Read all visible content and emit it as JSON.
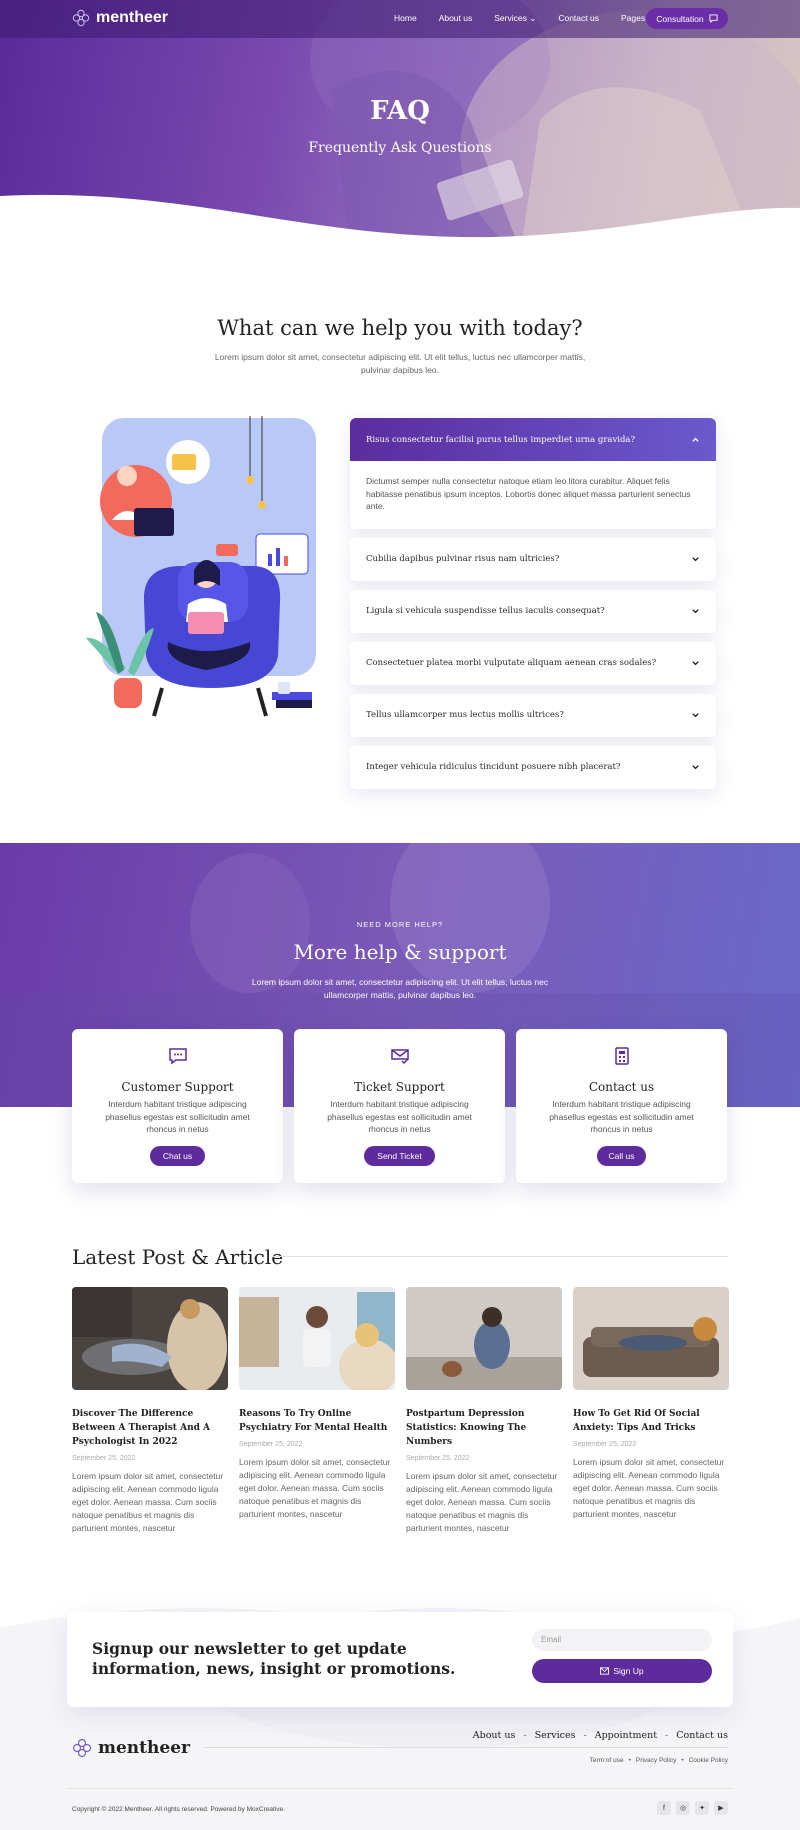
{
  "header": {
    "brand": "mentheer",
    "menu": [
      {
        "label": "Home",
        "dropdown": false
      },
      {
        "label": "About us",
        "dropdown": false
      },
      {
        "label": "Services",
        "dropdown": true
      },
      {
        "label": "Contact us",
        "dropdown": false
      },
      {
        "label": "Pages",
        "dropdown": true
      }
    ],
    "cta_label": "Consultation",
    "cta_icon": "message-square-icon"
  },
  "hero": {
    "title": "FAQ",
    "subtitle": "Frequently Ask Questions"
  },
  "help": {
    "title": "What can we help you with today?",
    "description": "Lorem ipsum dolor sit amet, consectetur adipiscing elit. Ut elit tellus, luctus nec ullamcorper mattis, pulvinar dapibus leo."
  },
  "faq": {
    "items": [
      {
        "question": "Risus consectetur facilisi purus tellus imperdiet urna gravida?",
        "answer": "Dictumst semper nulla consectetur natoque etiam leo litora curabitur. Aliquet felis habitasse penatibus ipsum inceptos. Lobortis donec aliquet massa parturient senectus ante.",
        "open": true
      },
      {
        "question": "Cubilia dapibus pulvinar risus nam ultricies?",
        "open": false
      },
      {
        "question": "Ligula si vehicula suspendisse tellus iaculis consequat?",
        "open": false
      },
      {
        "question": "Consectetuer platea morbi vulputate aliquam aenean cras sodales?",
        "open": false
      },
      {
        "question": "Tellus ullamcorper mus lectus mollis ultrices?",
        "open": false
      },
      {
        "question": "Integer vehicula ridiculus tincidunt posuere nibh placerat?",
        "open": false
      }
    ]
  },
  "support": {
    "tagline": "NEED MORE HELP?",
    "title": "More help & support",
    "description": "Lorem ipsum dolor sit amet, consectetur adipiscing elit. Ut elit tellus, luctus nec ullamcorper mattis, pulvinar dapibus leo.",
    "cards": [
      {
        "icon": "chat-bubble-icon",
        "title": "Customer Support",
        "text": "Interdum habitant tristique adipiscing phasellus egestas est sollicitudin amet rhoncus in netus",
        "button": "Chat us"
      },
      {
        "icon": "mail-check-icon",
        "title": "Ticket Support",
        "text": "Interdum habitant tristique adipiscing phasellus egestas est sollicitudin amet rhoncus in netus",
        "button": "Send Ticket"
      },
      {
        "icon": "phone-building-icon",
        "title": "Contact us",
        "text": "Interdum habitant tristique adipiscing phasellus egestas est sollicitudin amet rhoncus in netus",
        "button": "Call us"
      }
    ]
  },
  "posts": {
    "title": "Latest Post & Article",
    "items": [
      {
        "title": "Discover The Difference Between A Therapist And A Psychologist In 2022",
        "date": "September 25, 2022",
        "excerpt": "Lorem ipsum dolor sit amet, consectetur adipiscing elit. Aenean commodo ligula eget dolor. Aenean massa. Cum sociis natoque penatibus et magnis dis parturient montes, nascetur"
      },
      {
        "title": "Reasons To Try Online Psychiatry For Mental Health",
        "date": "September 25, 2022",
        "excerpt": "Lorem ipsum dolor sit amet, consectetur adipiscing elit. Aenean commodo ligula eget dolor. Aenean massa. Cum sociis natoque penatibus et magnis dis parturient montes, nascetur"
      },
      {
        "title": "Postpartum Depression Statistics: Knowing The Numbers",
        "date": "September 25, 2022",
        "excerpt": "Lorem ipsum dolor sit amet, consectetur adipiscing elit. Aenean commodo ligula eget dolor. Aenean massa. Cum sociis natoque penatibus et magnis dis parturient montes, nascetur"
      },
      {
        "title": "How To Get Rid Of Social Anxiety: Tips And Tricks",
        "date": "September 25, 2022",
        "excerpt": "Lorem ipsum dolor sit amet, consectetur adipiscing elit. Aenean commodo ligula eget dolor. Aenean massa. Cum sociis natoque penatibus et magnis dis parturient montes, nascetur"
      }
    ]
  },
  "newsletter": {
    "title": "Signup our newsletter to get update information, news, insight or promotions.",
    "email_placeholder": "Email",
    "button": "Sign Up"
  },
  "footer": {
    "brand": "mentheer",
    "links": [
      "About us",
      "Services",
      "Appointment",
      "Contact us"
    ],
    "legal": [
      "Term of use",
      "Privacy Policy",
      "Cookie Policy"
    ],
    "copyright": "Copyright © 2022 Mentheer. All rights reserved. Powered by MoxCreative.",
    "socials": [
      "facebook-icon",
      "instagram-icon",
      "twitter-icon",
      "youtube-icon"
    ]
  },
  "colors": {
    "brand_purple": "#5e2b9c",
    "accent_indigo": "#6a5acd",
    "footer_bg": "#f5f5f8"
  }
}
